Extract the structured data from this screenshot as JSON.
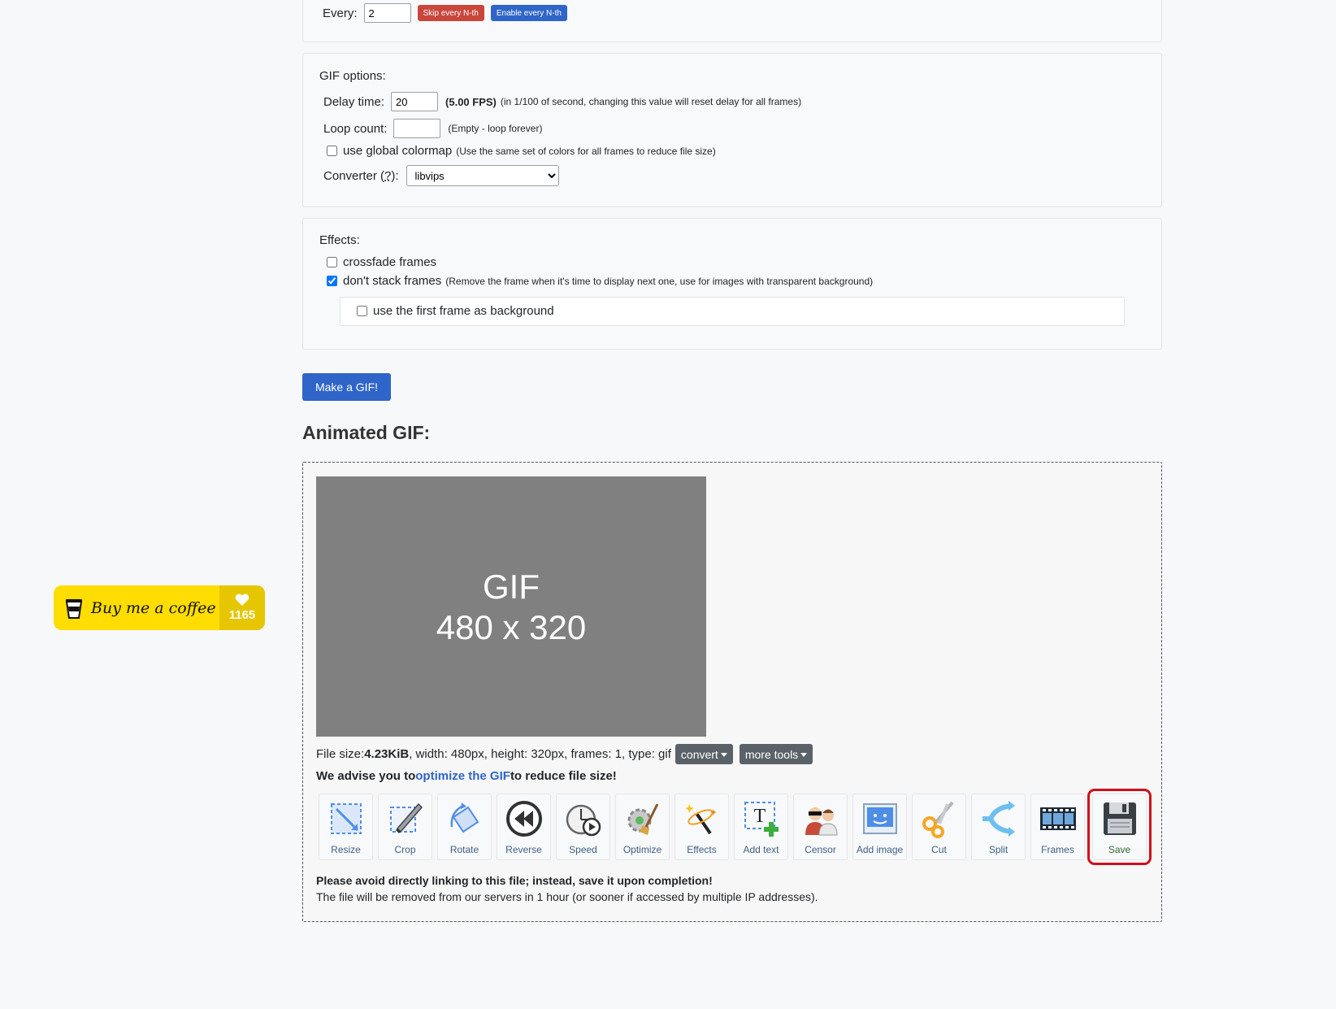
{
  "every": {
    "label": "Every:",
    "value": "2",
    "skip_label": "Skip every N-th",
    "enable_label": "Enable every N-th"
  },
  "gif_options": {
    "title": "GIF options:",
    "delay_label": "Delay time:",
    "delay_value": "20",
    "fps": "(5.00 FPS)",
    "delay_note": "(in 1/100 of second, changing this value will reset delay for all frames)",
    "loop_label": "Loop count:",
    "loop_value": "",
    "loop_note": "(Empty - loop forever)",
    "colormap_label": "use global colormap",
    "colormap_note": "(Use the same set of colors for all frames to reduce file size)",
    "converter_label": "Converter (",
    "converter_q": "?",
    "converter_label_end": "):",
    "converter_value": "libvips"
  },
  "effects": {
    "title": "Effects:",
    "crossfade_label": "crossfade frames",
    "nostack_label": "don't stack frames",
    "nostack_note": "(Remove the frame when it's time to display next one, use for images with transparent background)",
    "firstframe_label": "use the first frame as background"
  },
  "make_gif_label": "Make a GIF!",
  "result": {
    "heading": "Animated GIF:",
    "placeholder_line1": "GIF",
    "placeholder_line2": "480 x 320",
    "file_size_label": "File size: ",
    "file_size": "4.23KiB",
    "file_info": ", width: 480px, height: 320px, frames: 1, type: gif",
    "convert_label": "convert",
    "more_tools_label": "more tools",
    "advise_pre": "We advise you to ",
    "advise_link": "optimize the GIF",
    "advise_post": " to reduce file size!",
    "warning": "Please avoid directly linking to this file; instead, save it upon completion!",
    "removal_note": "The file will be removed from our servers in 1 hour (or sooner if accessed by multiple IP addresses)."
  },
  "tools": [
    {
      "label": "Resize",
      "icon": "resize-icon"
    },
    {
      "label": "Crop",
      "icon": "crop-icon"
    },
    {
      "label": "Rotate",
      "icon": "rotate-icon"
    },
    {
      "label": "Reverse",
      "icon": "reverse-icon"
    },
    {
      "label": "Speed",
      "icon": "speed-icon"
    },
    {
      "label": "Optimize",
      "icon": "optimize-icon"
    },
    {
      "label": "Effects",
      "icon": "effects-icon"
    },
    {
      "label": "Add text",
      "icon": "add-text-icon"
    },
    {
      "label": "Censor",
      "icon": "censor-icon"
    },
    {
      "label": "Add image",
      "icon": "add-image-icon"
    },
    {
      "label": "Cut",
      "icon": "scissors-icon"
    },
    {
      "label": "Split",
      "icon": "split-icon"
    },
    {
      "label": "Frames",
      "icon": "film-strip-icon"
    },
    {
      "label": "Save",
      "icon": "floppy-disk-icon"
    }
  ],
  "coffee": {
    "label": "Buy me a coffee",
    "count": "1165"
  },
  "colors": {
    "primary": "#2f65c9",
    "danger": "#c9463b",
    "highlight": "#d0101b",
    "coffee_yellow": "#ffdd00"
  }
}
